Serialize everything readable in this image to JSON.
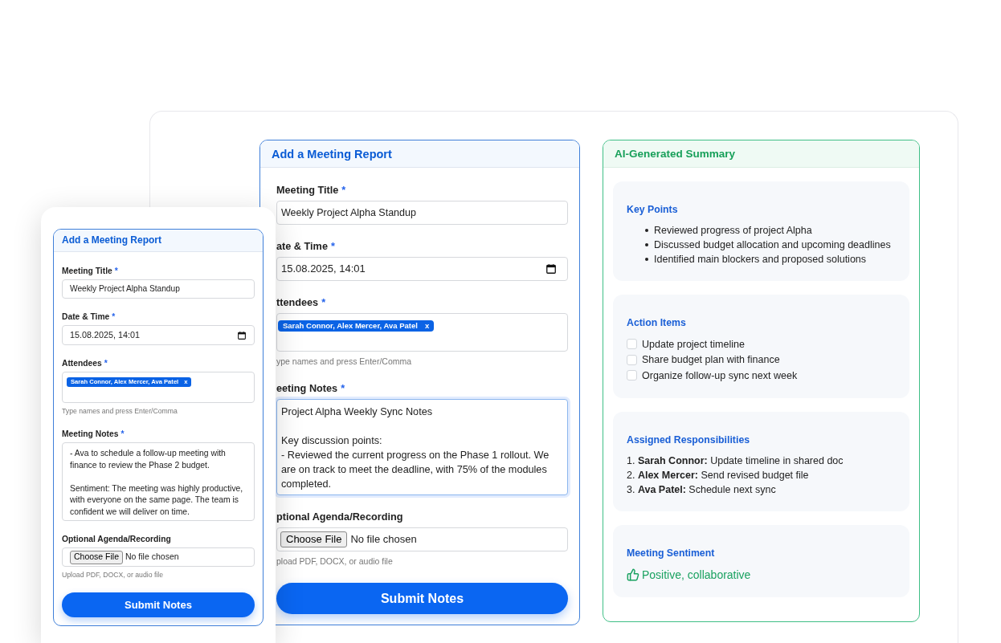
{
  "desktop": {
    "form": {
      "title": "Add a Meeting Report",
      "fields": [
        {
          "kind": "text",
          "label": "Meeting Title",
          "required_mark": "*",
          "value": "Weekly Project Alpha Standup"
        },
        {
          "kind": "datetime",
          "label": "ate & Time",
          "required_mark": "*",
          "value": "15.08.2025, 14:01"
        },
        {
          "kind": "tags",
          "label": "ttendees",
          "required_mark": "*",
          "tags": [
            {
              "text": "Sarah Connor, Alex Mercer, Ava Patel",
              "remove": "x"
            }
          ],
          "hint": "ype names and press Enter/Comma"
        },
        {
          "kind": "textarea",
          "label": "eeting Notes",
          "required_mark": "*",
          "focused": true,
          "value": "Project Alpha Weekly Sync Notes\n\nKey discussion points:\n- Reviewed the current progress on the Phase 1 rollout. We\nare on track to meet the deadline, with 75% of the modules\ncompleted."
        },
        {
          "kind": "file",
          "label": "ptional Agenda/Recording",
          "button": "Choose File",
          "value": "No file chosen",
          "hint": "pload PDF, DOCX, or audio file"
        }
      ],
      "submit": "Submit Notes"
    },
    "summary": {
      "title": "AI-Generated Summary",
      "sections": [
        {
          "kind": "bullets",
          "heading": "Key Points",
          "items": [
            "Reviewed progress of project Alpha",
            "Discussed budget allocation and upcoming deadlines",
            "Identified main blockers and proposed solutions"
          ]
        },
        {
          "kind": "checklist",
          "heading": "Action Items",
          "items": [
            {
              "text": "Update project timeline",
              "checked": false
            },
            {
              "text": "Share budget plan with finance",
              "checked": false
            },
            {
              "text": "Organize follow-up sync next week",
              "checked": false
            }
          ]
        },
        {
          "kind": "numbered",
          "heading": "Assigned Responsibilities",
          "items": [
            "1. **Sarah Connor:** Update timeline in shared doc",
            "2. **Alex Mercer:** Send revised budget file",
            "3. **Ava Patel:** Schedule next sync"
          ]
        },
        {
          "kind": "sentiment",
          "heading": "Meeting Sentiment",
          "text": "Positive, collaborative"
        }
      ]
    }
  },
  "mobile": {
    "form": {
      "title": "Add a Meeting Report",
      "fields": [
        {
          "kind": "text",
          "label": "Meeting Title",
          "required_mark": "*",
          "value": "Weekly Project Alpha Standup"
        },
        {
          "kind": "datetime",
          "label": "Date & Time",
          "required_mark": "*",
          "value": "15.08.2025, 14:01"
        },
        {
          "kind": "tags",
          "label": "Attendees",
          "required_mark": "*",
          "tags": [
            {
              "text": "Sarah Connor, Alex Mercer, Ava Patel",
              "remove": "x"
            }
          ],
          "hint": "Type names and press Enter/Comma"
        },
        {
          "kind": "textarea",
          "label": "Meeting Notes",
          "required_mark": "*",
          "focused": false,
          "value": "- Ava to schedule a follow-up meeting with\nfinance to review the Phase 2 budget.\n\nSentiment: The meeting was highly productive,\nwith everyone on the same page. The team is\nconfident we will deliver on time."
        },
        {
          "kind": "file",
          "label": "Optional Agenda/Recording",
          "button": "Choose File",
          "value": "No file chosen",
          "hint": "Upload PDF, DOCX, or audio file"
        }
      ],
      "submit": "Submit Notes"
    }
  }
}
